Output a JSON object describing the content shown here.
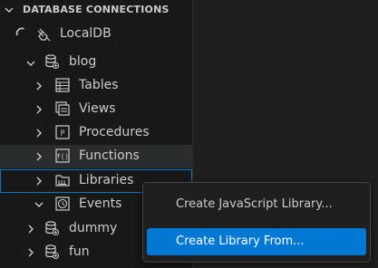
{
  "sidebar": {
    "header": "DATABASE CONNECTIONS",
    "tree": {
      "connection": "LocalDB",
      "database": "blog",
      "folders": [
        "Tables",
        "Views",
        "Procedures",
        "Functions",
        "Libraries",
        "Events"
      ],
      "other_databases": [
        "dummy",
        "fun"
      ]
    }
  },
  "context_menu": {
    "items": [
      "Create JavaScript Library...",
      "Create Library From..."
    ],
    "selected": "Create Library From..."
  },
  "colors": {
    "focus_border": "#0078d4",
    "selection": "#0078d4",
    "hover_row": "#2a2d2e",
    "sidebar_bg": "#181818"
  }
}
